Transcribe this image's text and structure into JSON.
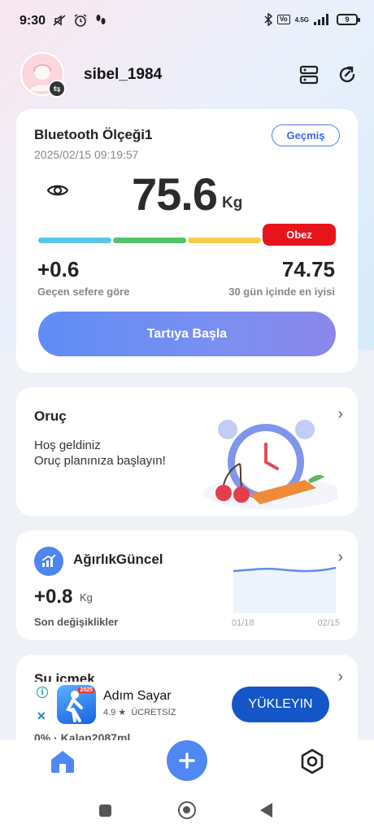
{
  "status_bar": {
    "time": "9:30",
    "network": "4.5G",
    "battery": "9"
  },
  "header": {
    "username": "sibel_1984"
  },
  "scale_card": {
    "device_name": "Bluetooth Ölçeği1",
    "timestamp": "2025/02/15 09:19:57",
    "history_label": "Geçmiş",
    "weight_value": "75.6",
    "weight_unit": "Kg",
    "bmi_badge": "Obez",
    "bar_colors": [
      "#5bc6ea",
      "#53c46b",
      "#f3cd4c",
      "#e8141c"
    ],
    "change_value": "+0.6",
    "change_label": "Geçen sefere göre",
    "best_value": "74.75",
    "best_label": "30 gün içinde en iyisi",
    "start_button": "Tartıya Başla"
  },
  "fasting_card": {
    "title": "Oruç",
    "line1": "Hoş geldiniz",
    "line2": "Oruç planınıza başlayın!"
  },
  "weight_card": {
    "title": "AğırlıkGüncel",
    "value": "+0.8",
    "unit": "Kg",
    "label": "Son değişiklikler",
    "date_start": "01/18",
    "date_end": "02/15"
  },
  "water_card": {
    "title": "Su içmek",
    "subtitle": "0% · Kalan2087ml"
  },
  "ad": {
    "app_name": "Adım Sayar",
    "rating": "4.9 ★",
    "price": "ÜCRETSİZ",
    "badge": "2025",
    "install_label": "YÜKLEYIN"
  },
  "colors": {
    "accent": "#4f88f2",
    "danger": "#e8141c"
  }
}
